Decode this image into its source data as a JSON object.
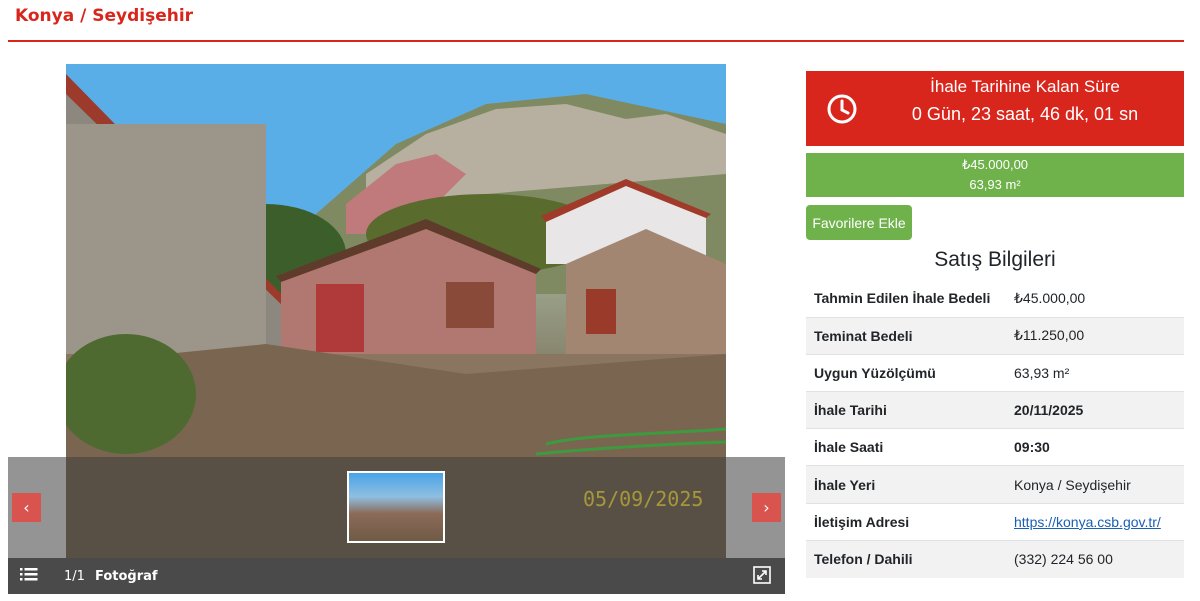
{
  "header": {
    "title": "Konya / Seydişehir"
  },
  "gallery": {
    "prev_label": "‹",
    "next_label": "›",
    "watermark_date": "05/09/2025",
    "counter": "1/1",
    "photo_label": "Fotoğraf",
    "icons": {
      "list": "list-icon",
      "expand": "expand-icon"
    }
  },
  "countdown": {
    "title": "İhale Tarihine Kalan Süre",
    "value": "0 Gün, 23 saat, 46 dk, 01 sn",
    "icon": "clock-icon"
  },
  "price": {
    "amount": "₺45.000,00",
    "area": "63,93 m²"
  },
  "favorite_button": "Favorilere Ekle",
  "sale_info": {
    "title": "Satış Bilgileri",
    "rows": [
      {
        "label": "Tahmin Edilen İhale Bedeli",
        "value": "₺45.000,00"
      },
      {
        "label": "Teminat Bedeli",
        "value": "₺11.250,00"
      },
      {
        "label": "Uygun Yüzölçümü",
        "value": "63,93 m²"
      },
      {
        "label": "İhale Tarihi",
        "value": "20/11/2025"
      },
      {
        "label": "İhale Saati",
        "value": "09:30"
      },
      {
        "label": "İhale Yeri",
        "value": "Konya / Seydişehir"
      },
      {
        "label": "İletişim Adresi",
        "value": "https://konya.csb.gov.tr/"
      },
      {
        "label": "Telefon / Dahili",
        "value": "(332) 224 56 00"
      }
    ]
  },
  "colors": {
    "brand_red": "#d9261c",
    "green": "#6fb24b",
    "link": "#1a5fb4"
  }
}
